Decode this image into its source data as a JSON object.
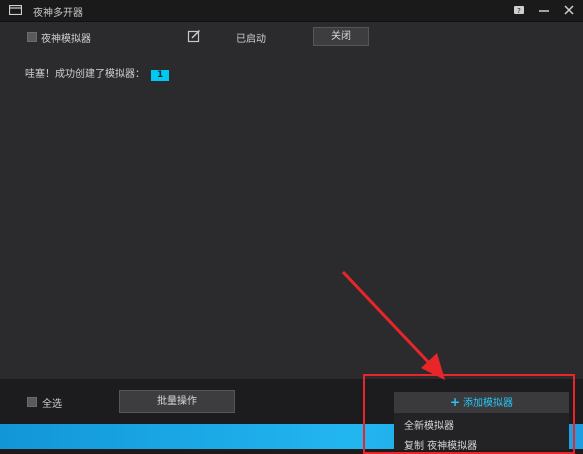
{
  "window": {
    "title": "夜神多开器",
    "icons": [
      "window-app-icon",
      "help-icon",
      "minimize-icon",
      "close-icon"
    ]
  },
  "emulator_row": {
    "name": "夜神模拟器",
    "edit_icon": "edit-icon",
    "status": "已启动",
    "close_label": "关闭"
  },
  "message": {
    "text": "哇塞！成功创建了模拟器：",
    "count": "1"
  },
  "bottom": {
    "select_all": "全选",
    "batch_label": "批量操作",
    "add_label": "添加模拟器",
    "add_icon": "plus-icon"
  },
  "dropdown": {
    "items": [
      "全新模拟器",
      "复制 夜神模拟器"
    ]
  },
  "colors": {
    "accent": "#27c6f4",
    "badge": "#00c8f2",
    "annotation": "#e8262a",
    "panel": "#2b2b2d",
    "titlebar": "#1a1a1a"
  }
}
